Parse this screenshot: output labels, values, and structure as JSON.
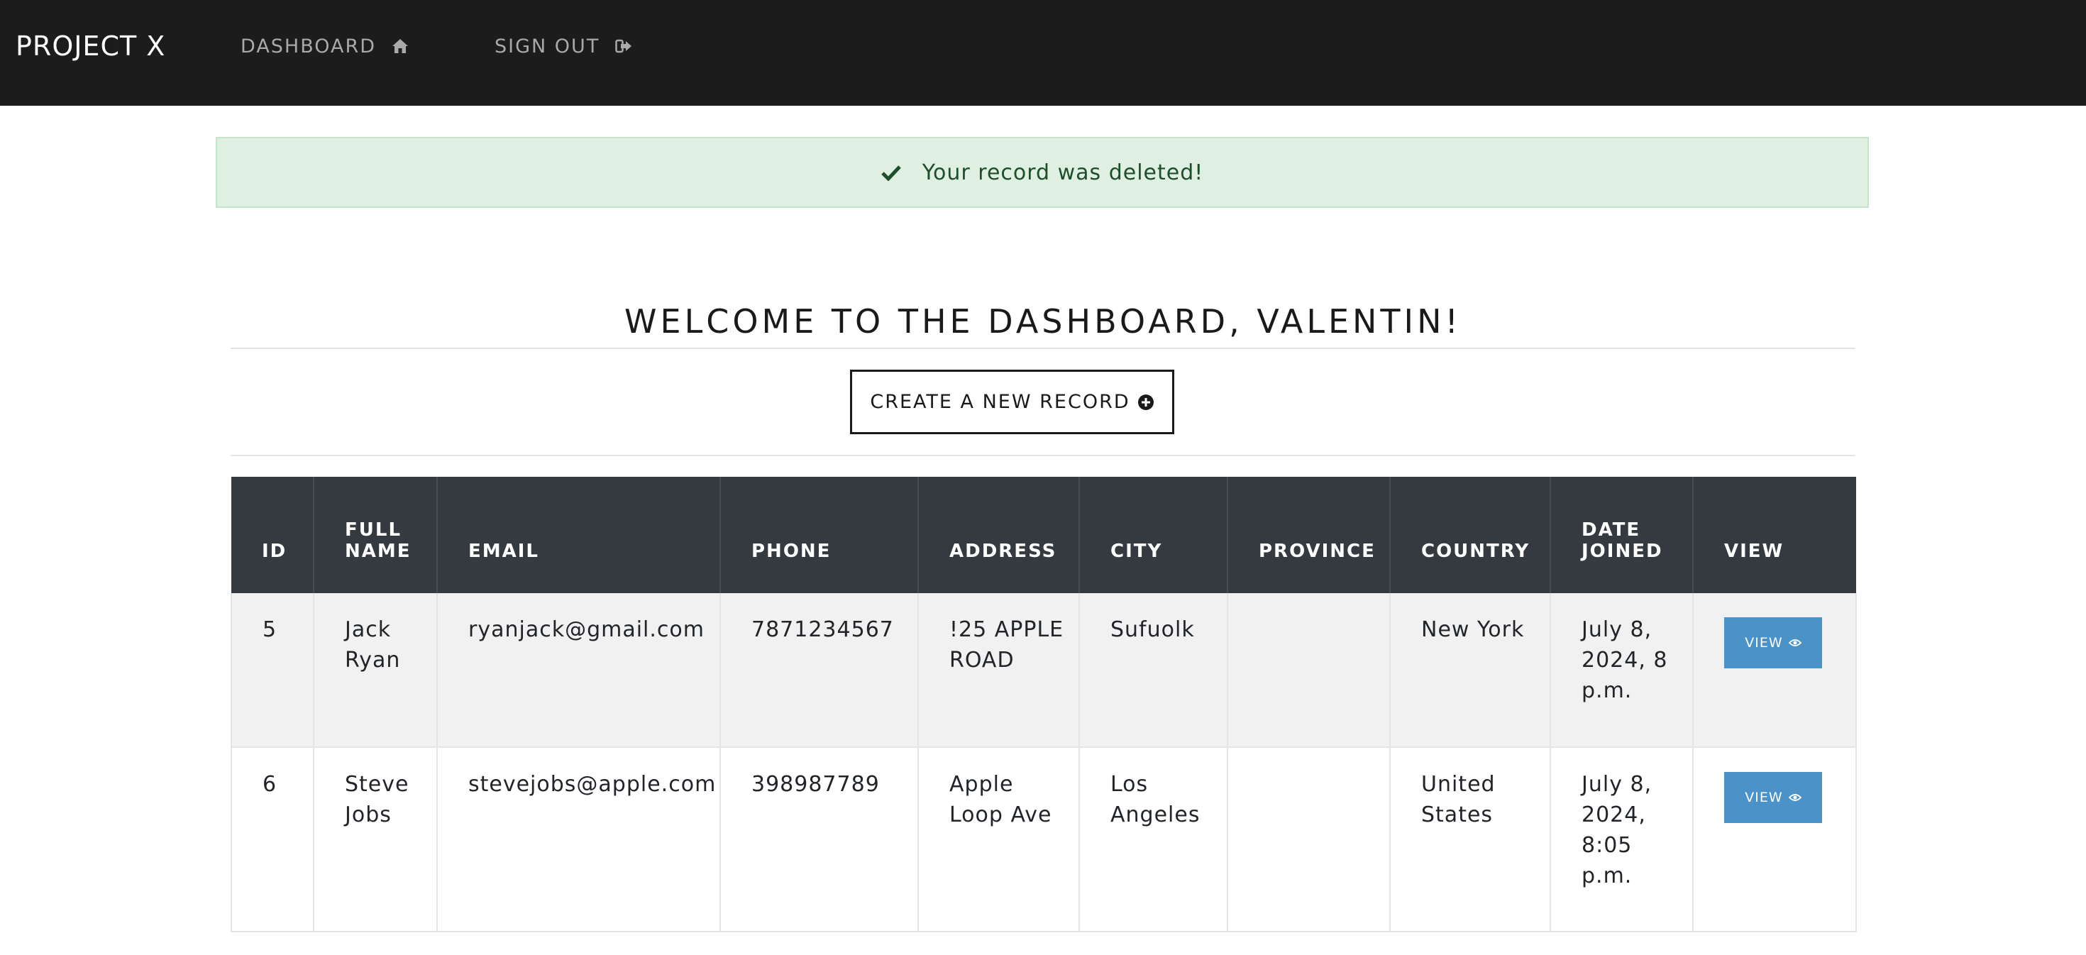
{
  "navbar": {
    "brand": "PROJECT X",
    "links": [
      {
        "label": "DASHBOARD",
        "icon": "home-icon"
      },
      {
        "label": "SIGN OUT",
        "icon": "sign-out-icon"
      }
    ]
  },
  "alert": {
    "icon": "check-icon",
    "message": "Your record was deleted!"
  },
  "main": {
    "heading": "WELCOME TO THE DASHBOARD, VALENTIN!",
    "create_button": {
      "label": "CREATE A NEW RECORD",
      "icon": "plus-circle-icon"
    }
  },
  "table": {
    "headers": [
      "ID",
      "FULL NAME",
      "EMAIL",
      "PHONE",
      "ADDRESS",
      "CITY",
      "PROVINCE",
      "COUNTRY",
      "DATE JOINED",
      "VIEW"
    ],
    "rows": [
      {
        "id": "5",
        "full_name": "Jack Ryan",
        "email": "ryanjack@gmail.com",
        "phone": "7871234567",
        "address": "!25 APPLE ROAD",
        "city": "Sufuolk",
        "province": "",
        "country": "New York",
        "date_joined": "July 8, 2024, 8 p.m.",
        "view_label": "VIEW"
      },
      {
        "id": "6",
        "full_name": "Steve Jobs",
        "email": "stevejobs@apple.com",
        "phone": "398987789",
        "address": "Apple Loop Ave",
        "city": "Los Angeles",
        "province": "",
        "country": "United States",
        "date_joined": "July 8, 2024, 8:05 p.m.",
        "view_label": "VIEW"
      }
    ]
  },
  "colors": {
    "navbar_bg": "#1c1c1c",
    "alert_bg": "#dff0e3",
    "table_header_bg": "#343a40",
    "view_button_bg": "#4a92c8"
  }
}
